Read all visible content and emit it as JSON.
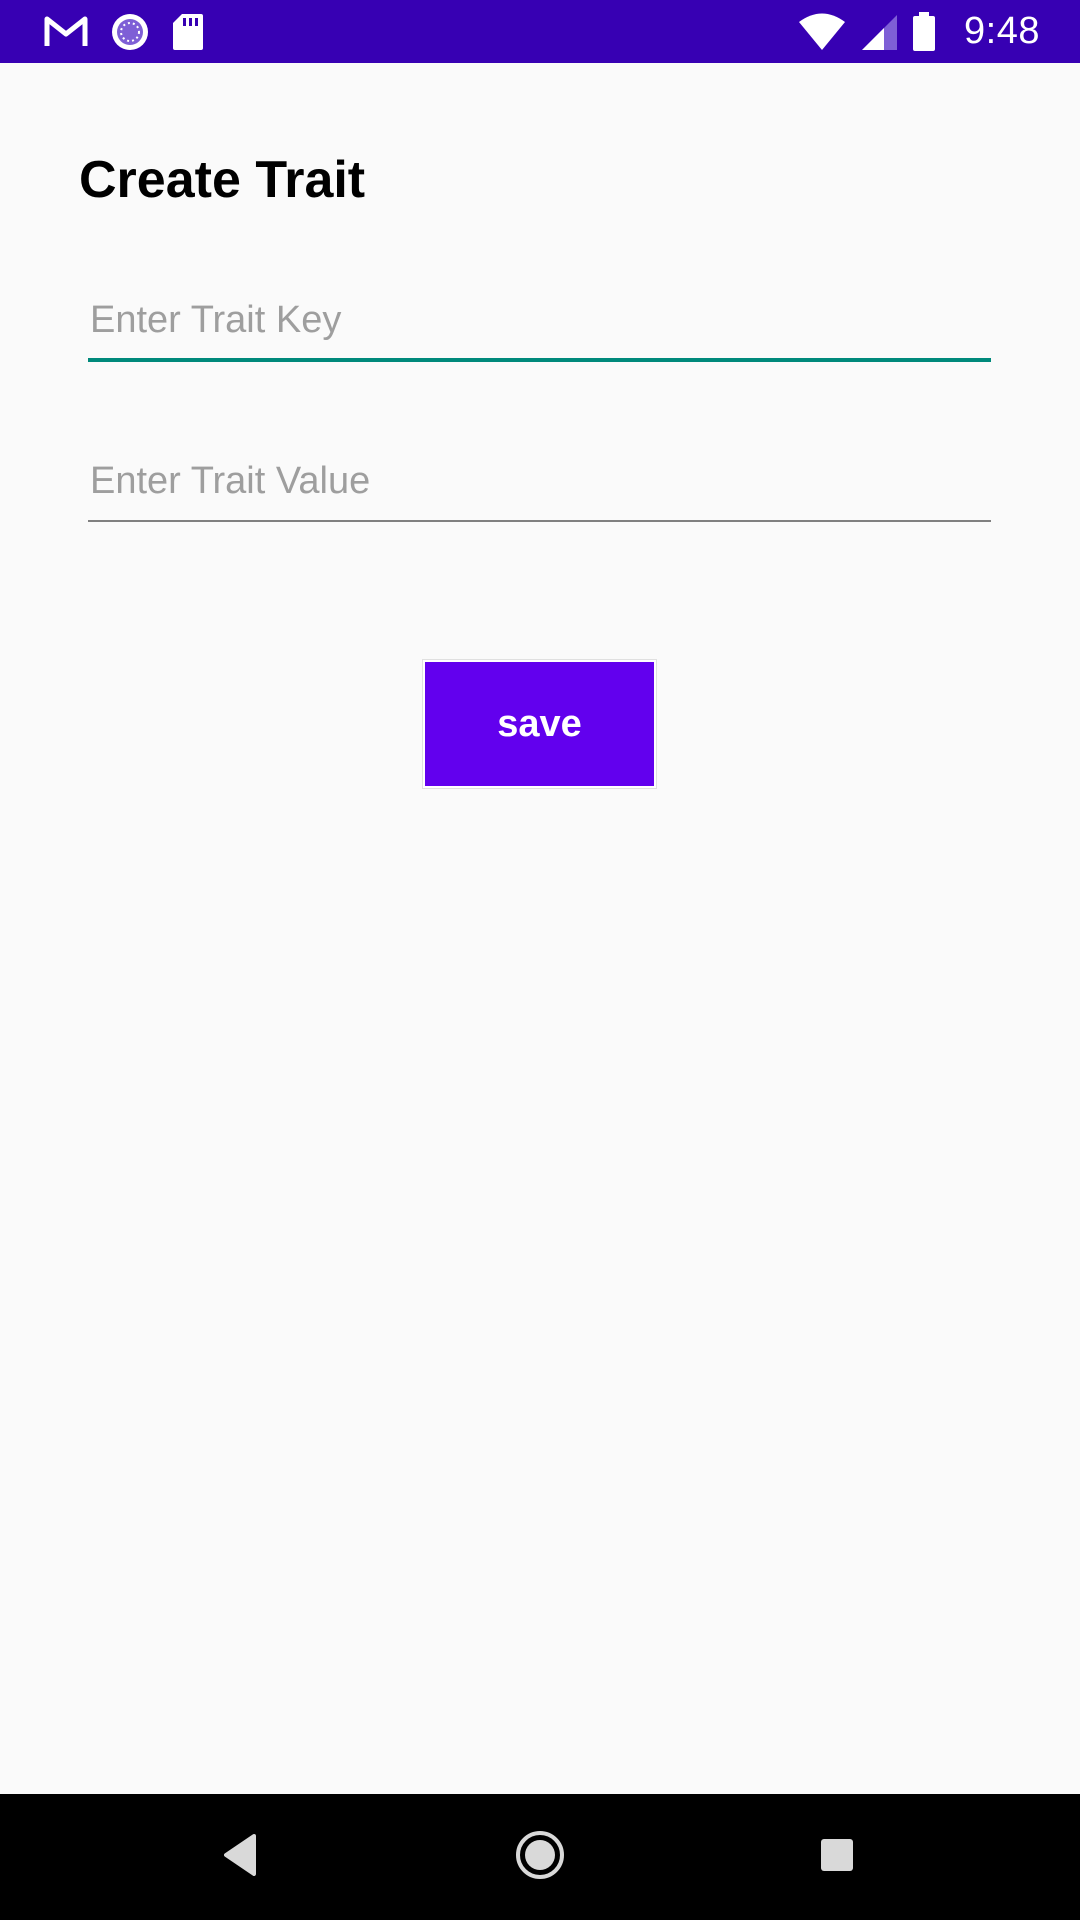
{
  "status_bar": {
    "time": "9:48",
    "background_color": "#3700b3",
    "left_icons": [
      "gmail-icon",
      "loading-icon",
      "sd-card-icon"
    ],
    "right_icons": [
      "wifi-icon",
      "cellular-signal-icon",
      "battery-icon"
    ]
  },
  "page": {
    "title": "Create Trait"
  },
  "form": {
    "key_field": {
      "placeholder": "Enter Trait Key",
      "value": "",
      "underline_color": "#00897b"
    },
    "value_field": {
      "placeholder": "Enter Trait Value",
      "value": "",
      "underline_color": "#808080"
    },
    "save_label": "save",
    "save_color": "#6200ee"
  },
  "nav_bar": {
    "icons": [
      "back-icon",
      "home-icon",
      "recents-icon"
    ]
  }
}
